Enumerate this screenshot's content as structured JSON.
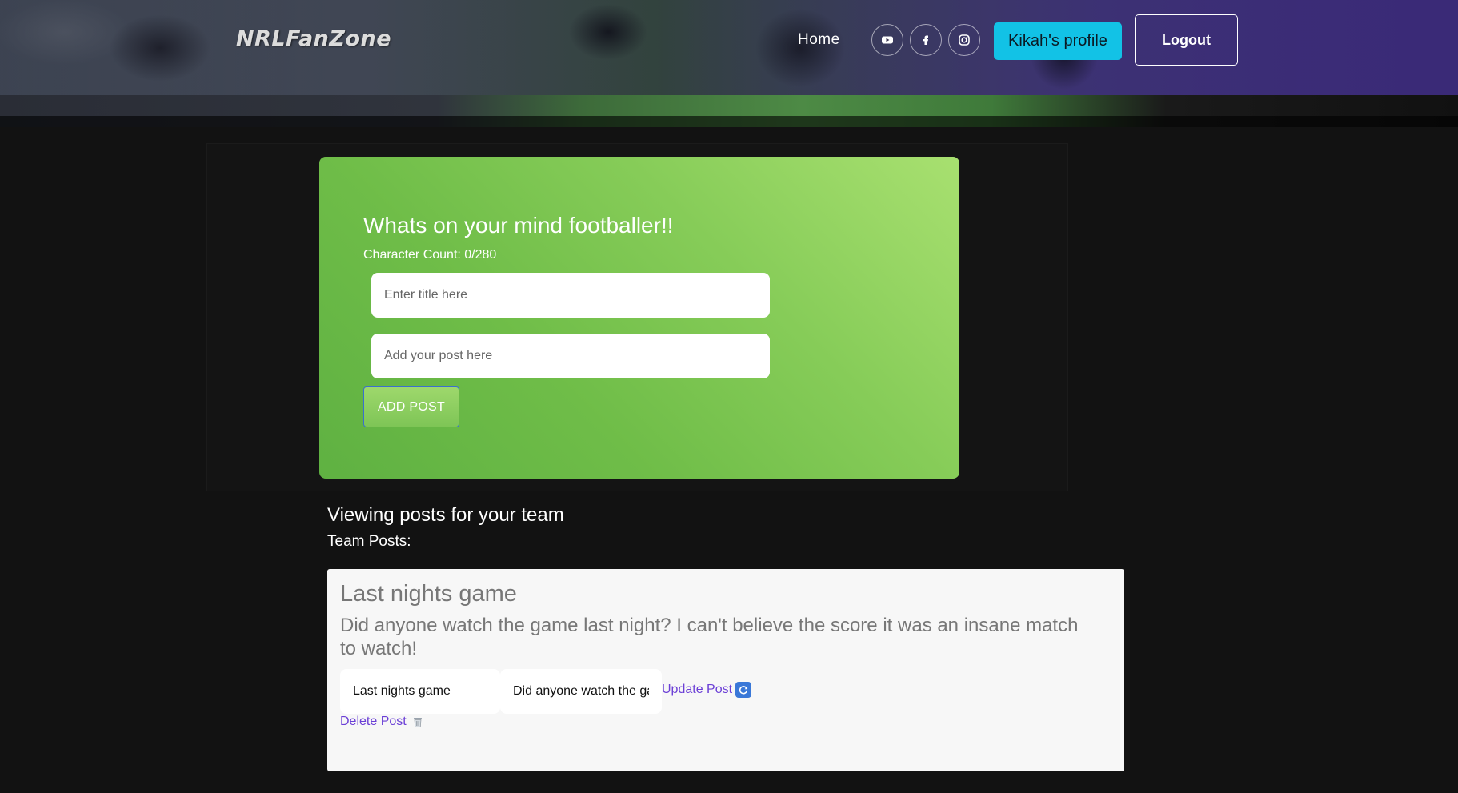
{
  "header": {
    "logo": "NRLFanZone",
    "nav_home": "Home",
    "social_icons": [
      "youtube-icon",
      "facebook-icon",
      "instagram-icon"
    ],
    "profile_button": "Kikah's profile",
    "logout_button": "Logout"
  },
  "composer": {
    "title": "Whats on your mind footballer!!",
    "char_count": "Character Count: 0/280",
    "title_placeholder": "Enter title here",
    "post_placeholder": "Add your post here",
    "add_button": "ADD POST"
  },
  "feed": {
    "section_title": "Viewing posts for your team",
    "team_posts_label": "Team Posts:",
    "posts": [
      {
        "title": "Last nights game",
        "body": "Did anyone watch the game last night? I can't believe the score it was an insane match to watch!",
        "edit_title_value": "Last nights game",
        "edit_body_value": "Did anyone watch the game last night? I can't believe the score it was an insane match to watch!",
        "update_label": "Update Post",
        "update_icon": "refresh-icon",
        "delete_label": "Delete Post",
        "delete_icon": "trash-icon"
      }
    ]
  },
  "colors": {
    "accent_cyan": "#12c2e6",
    "card_green": "#6fbd48",
    "link_purple": "#6b3fd6"
  }
}
